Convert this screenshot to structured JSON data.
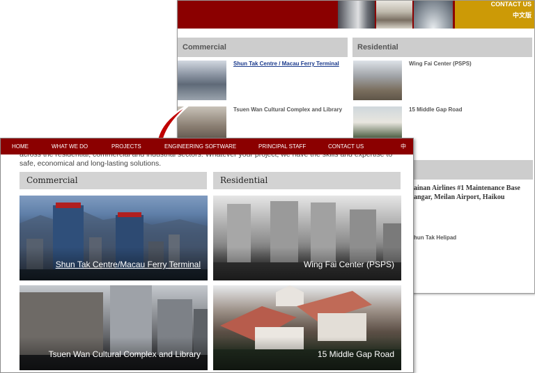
{
  "old_site": {
    "contact_label": "CONTACT US",
    "language_label": "中文版",
    "sections": {
      "commercial": "Commercial",
      "residential": "Residential"
    },
    "commercial_items": [
      "Shun Tak Centre / Macau Ferry Terminal",
      "Tsuen Wan Cultural Complex and Library"
    ],
    "residential_items": [
      "Wing Fai Center (PSPS)",
      "15 Middle Gap Road"
    ],
    "infrastructure_items": {
      "line1": "ainan Airlines #1 Maintenance Base",
      "line2": "angar, Meilan Airport, Haikou",
      "line3": "hun Tak Helipad"
    },
    "colors": {
      "header": "#8b0000",
      "gold": "#cc9a06",
      "section_bg": "#cdcdcd"
    }
  },
  "arrow": {
    "color": "#c00000",
    "direction": "down-left"
  },
  "new_site": {
    "nav": {
      "home": "HOME",
      "what_we_do": "WHAT WE DO",
      "projects": "PROJECTS",
      "engineering_software": "ENGINEERING SOFTWARE",
      "principal_staff": "PRINCIPAL STAFF",
      "contact_us": "CONTACT US",
      "language": "中"
    },
    "intro": {
      "line1": "across the residential, commercial and industrial sectors. Whatever your project, we have the skills and expertise to provide",
      "line2": "safe, economical and long-lasting solutions."
    },
    "categories": {
      "commercial": "Commercial",
      "residential": "Residential"
    },
    "projects": [
      {
        "title": "Shun Tak Centre/Macau Ferry Terminal",
        "category": "Commercial"
      },
      {
        "title": "Wing Fai Center (PSPS)",
        "category": "Residential"
      },
      {
        "title": "Tsuen Wan Cultural Complex and Library",
        "category": "Commercial"
      },
      {
        "title": "15 Middle Gap Road",
        "category": "Residential"
      }
    ],
    "colors": {
      "nav": "#8b0000",
      "category_bg": "#d3d3d3"
    }
  }
}
